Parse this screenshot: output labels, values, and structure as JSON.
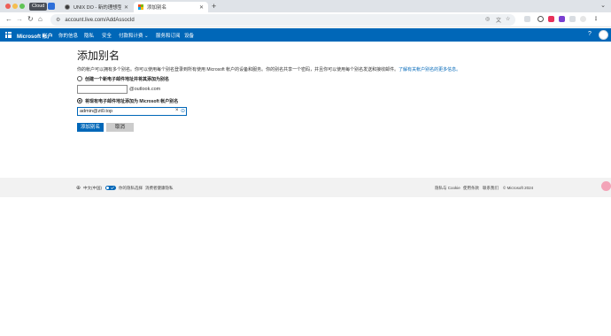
{
  "browser": {
    "profile_chip": "Cloud",
    "tabs": [
      {
        "title": "UNIX DO - 新的理想型社区"
      },
      {
        "title": "添加别名"
      }
    ],
    "url": "account.live.com/AddAssocId"
  },
  "header": {
    "brand": "Microsoft 帐户",
    "nav": [
      "你的信息",
      "隐私",
      "安全",
      "付款和计费",
      "服务和订阅",
      "设备"
    ],
    "nav_dropdown_index": 3,
    "help": "?"
  },
  "main": {
    "title": "添加别名",
    "description": "你的帐户可以拥有多个别名。你可以使用每个别名登录到所有使用 Microsoft 帐户的设备和服务。你的别名共享一个密码，并且你可以使用每个别名发送和接收邮件。",
    "learn_more": "了解有关帐户别名的更多信息。",
    "option_new": {
      "label": "创建一个新电子邮件地址并将其添加为别名",
      "input_value": "",
      "domain": "@outlook.com",
      "selected": false
    },
    "option_existing": {
      "label": "将现有电子邮件地址添加为 Microsoft 帐户别名",
      "input_value": "admin@zt0.top",
      "selected": true
    },
    "buttons": {
      "primary": "添加别名",
      "secondary": "取消"
    }
  },
  "footer": {
    "language": "中文(中国)",
    "privacy_choices": "你的隐私选择",
    "consumer_health": "消费者健康隐私",
    "privacy_cookies": "隐私与 Cookie",
    "terms": "使用条款",
    "contact": "联系我们",
    "copyright": "© Microsoft 2024"
  },
  "colors": {
    "brand_blue": "#0067b8",
    "secondary_button": "#cccccc",
    "footer_bg": "#f2f2f2"
  },
  "icons": [
    "back-icon",
    "forward-icon",
    "reload-icon",
    "home-icon",
    "site-info-icon",
    "globe-icon",
    "clear-icon",
    "autofill-icon",
    "waffle-icon"
  ]
}
